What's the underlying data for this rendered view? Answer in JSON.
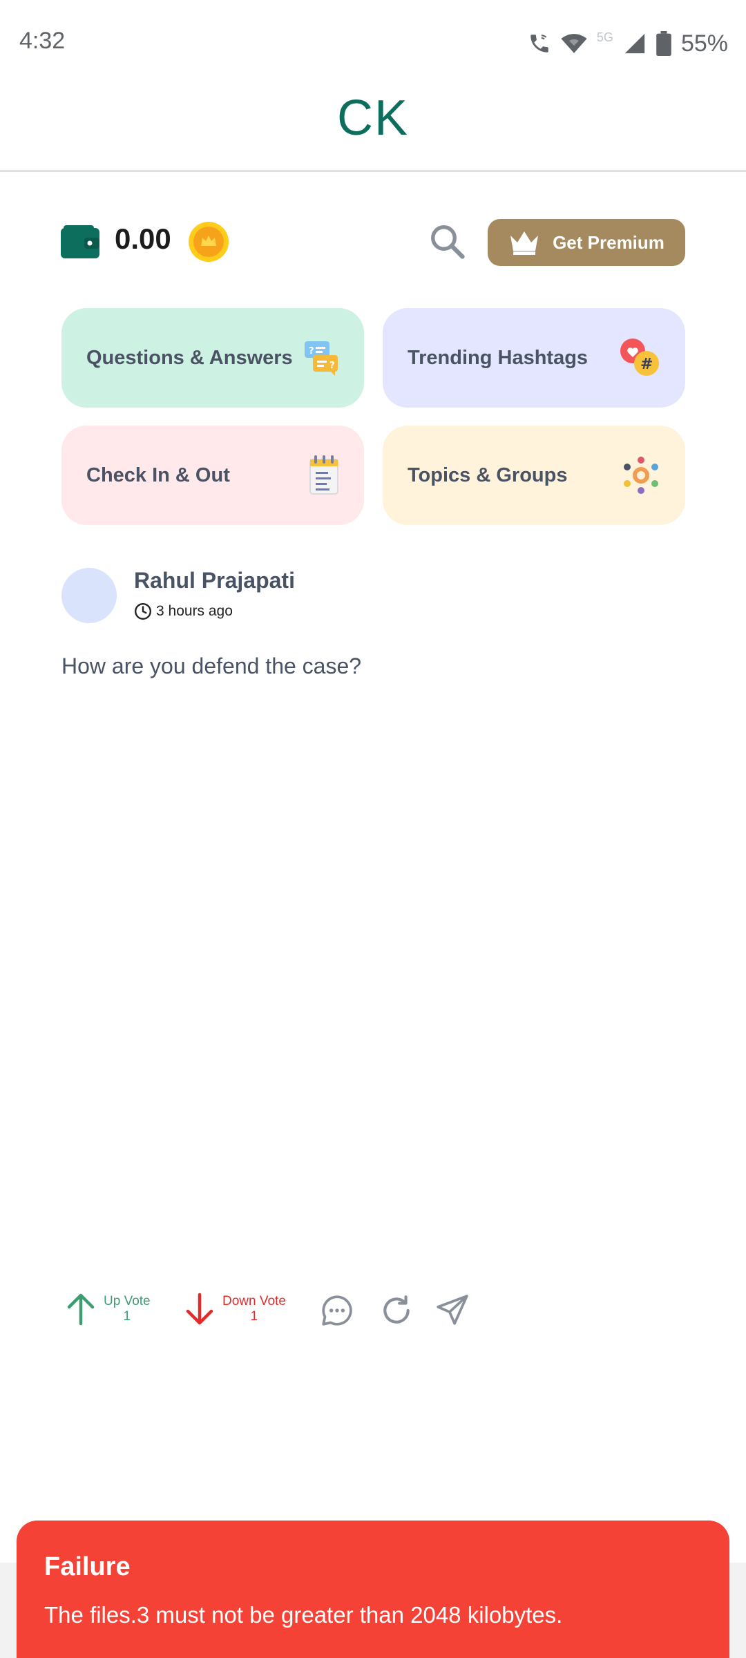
{
  "status_bar": {
    "time": "4:32",
    "network": "5G",
    "battery": "55%"
  },
  "app": {
    "title": "CK"
  },
  "wallet": {
    "balance": "0.00"
  },
  "premium": {
    "label": "Get Premium"
  },
  "cards": {
    "qa": "Questions & Answers",
    "trending": "Trending Hashtags",
    "checkin": "Check In & Out",
    "topics": "Topics & Groups"
  },
  "post": {
    "author": "Rahul Prajapati",
    "time": "3 hours ago",
    "text": "How are you defend the case?",
    "upvote_label": "Up Vote",
    "upvote_count": "1",
    "downvote_label": "Down Vote",
    "downvote_count": "1"
  },
  "toast": {
    "title": "Failure",
    "message": "The files.3 must not be greater than 2048 kilobytes."
  },
  "colors": {
    "brand": "#0d6e5e",
    "premium": "#a68a5f",
    "upvote": "#3e9c72",
    "downvote": "#e12b2b",
    "toast": "#f44336"
  }
}
